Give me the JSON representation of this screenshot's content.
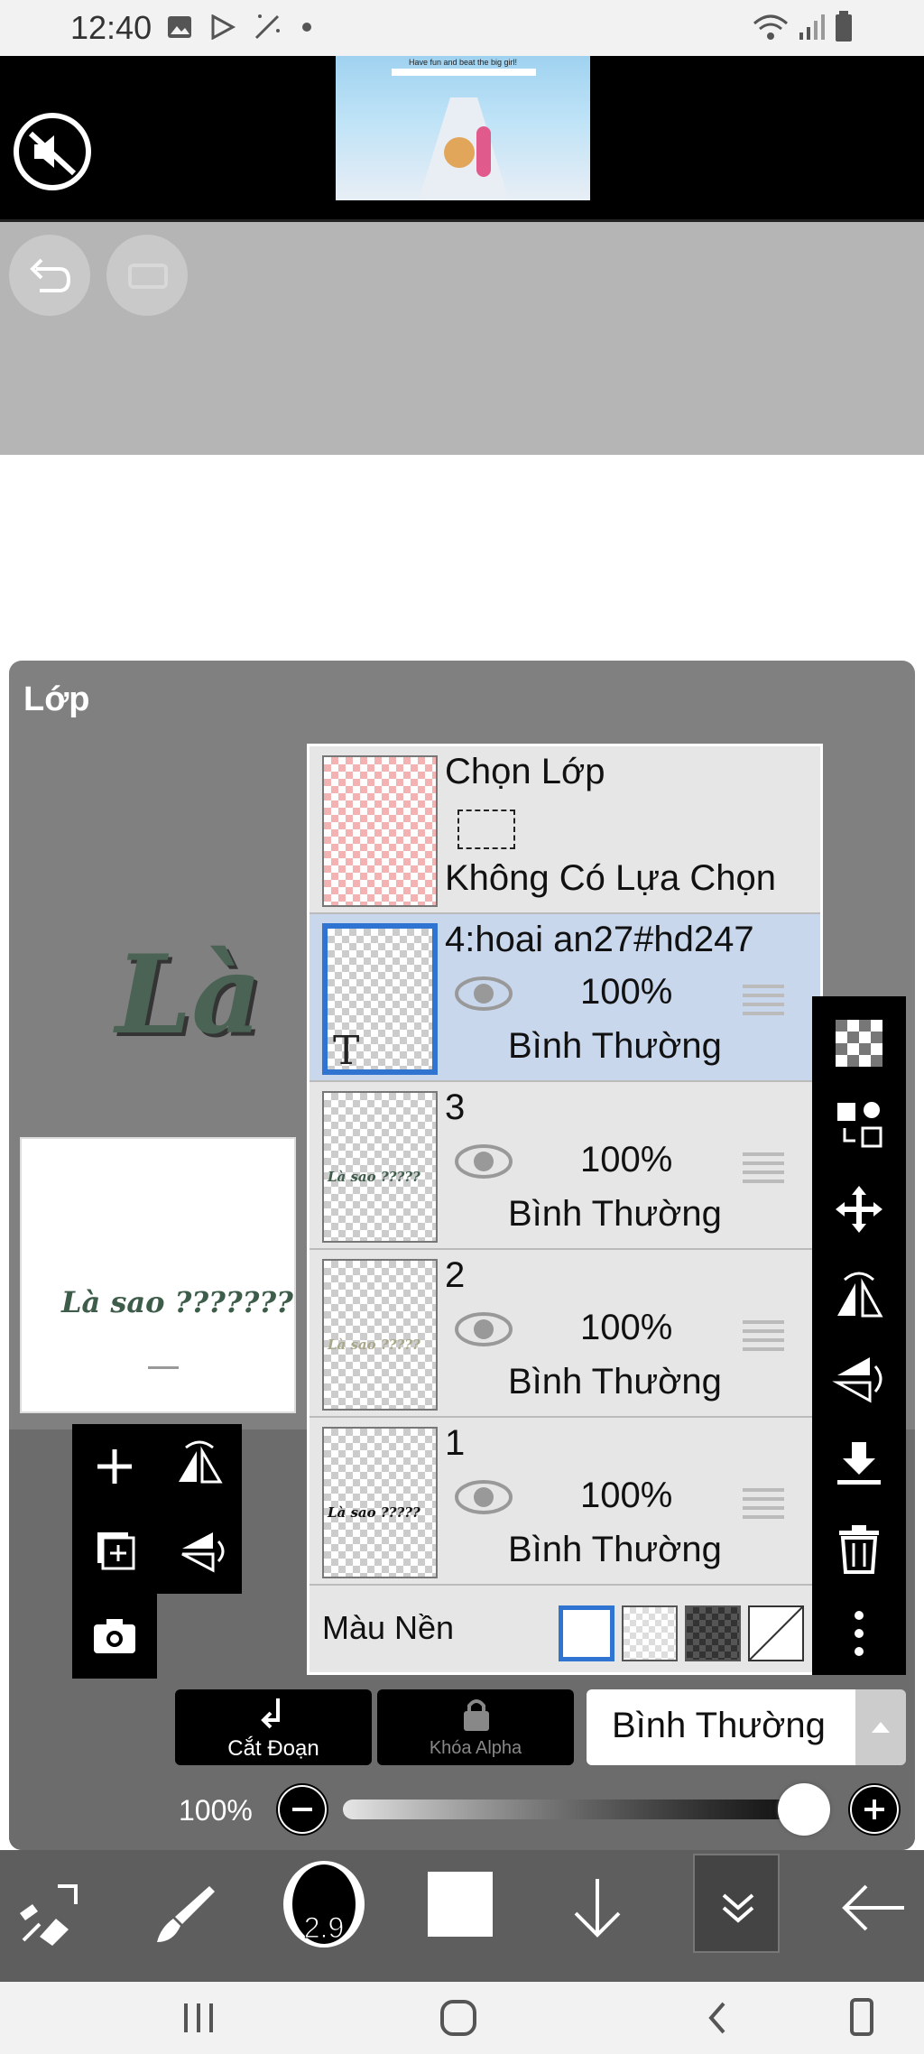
{
  "status_bar": {
    "time": "12:40"
  },
  "ad": {
    "caption": "Have fun and beat the big girl!"
  },
  "layers_panel": {
    "title": "Lớp",
    "selection_row": {
      "label": "Chọn Lớp",
      "subtitle": "Không Có Lựa Chọn"
    },
    "layers": [
      {
        "name": "4:hoai an27#hd247",
        "opacity": "100%",
        "mode": "Bình Thường",
        "selected": true,
        "thumb_text": "T"
      },
      {
        "name": "3",
        "opacity": "100%",
        "mode": "Bình Thường",
        "selected": false,
        "thumb_text": "Là sao ?????"
      },
      {
        "name": "2",
        "opacity": "100%",
        "mode": "Bình Thường",
        "selected": false,
        "thumb_text": "Là sao ?????"
      },
      {
        "name": "1",
        "opacity": "100%",
        "mode": "Bình Thường",
        "selected": false,
        "thumb_text": "Là sao ?????"
      }
    ],
    "background_label": "Màu Nền",
    "preview_text": "Là sao ???????",
    "canvas_text": "Là"
  },
  "bottom_controls": {
    "clip_label": "Cắt Đoạn",
    "alpha_lock_label": "Khóa Alpha",
    "blend_mode": "Bình Thường",
    "opacity_value": "100%",
    "opacity_fraction": 1.0
  },
  "toolbar": {
    "brush_size": "2.9"
  },
  "colors": {
    "accent": "#2f74d0",
    "selected_row": "#c9d7ec",
    "panel": "#808080"
  }
}
